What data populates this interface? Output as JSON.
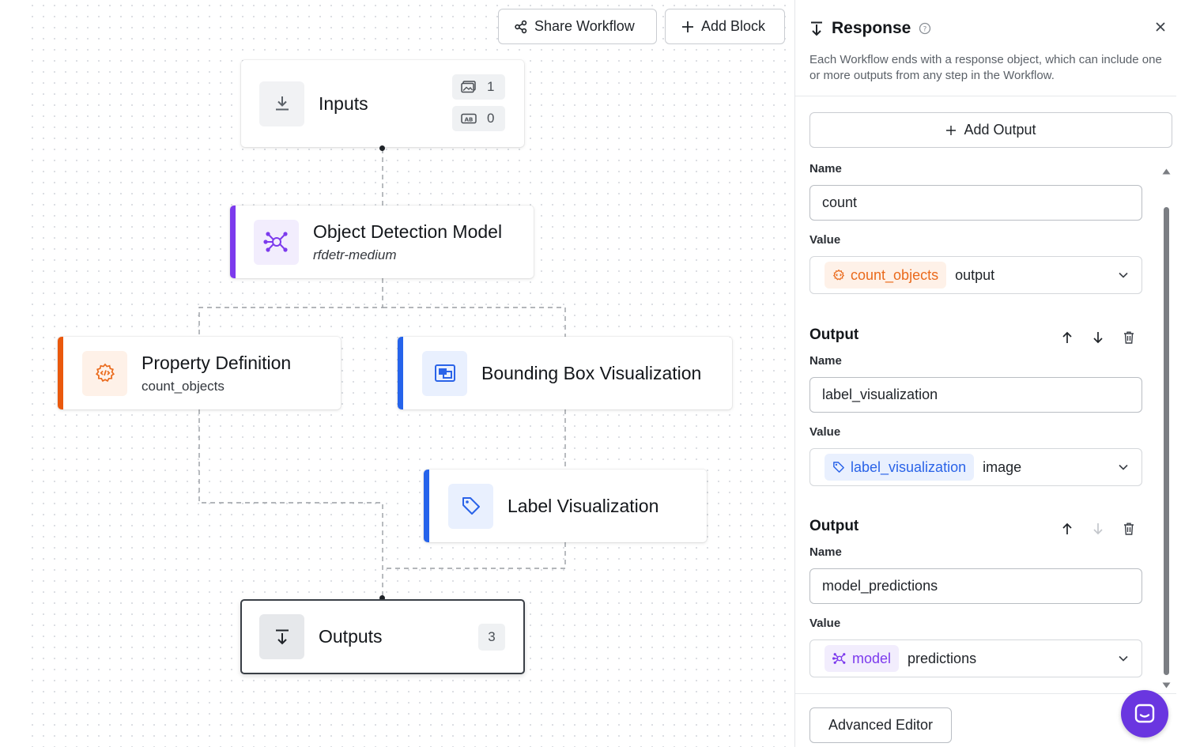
{
  "toolbar": {
    "share_label": "Share Workflow",
    "add_block_label": "Add Block"
  },
  "nodes": {
    "inputs": {
      "title": "Inputs",
      "image_count": "1",
      "param_count": "0"
    },
    "object_detection": {
      "title": "Object Detection Model",
      "subtitle": "rfdetr-medium",
      "accent": "#7c3aed"
    },
    "property_definition": {
      "title": "Property Definition",
      "subtitle": "count_objects",
      "accent": "#ea580c"
    },
    "bounding_box": {
      "title": "Bounding Box Visualization",
      "accent": "#2563eb"
    },
    "label_viz": {
      "title": "Label Visualization",
      "accent": "#2563eb"
    },
    "outputs": {
      "title": "Outputs",
      "count": "3"
    }
  },
  "panel": {
    "title": "Response",
    "description": "Each Workflow ends with a response object, which can include one or more outputs from any step in the Workflow.",
    "add_output_label": "Add Output",
    "outputs": [
      {
        "section_title": "",
        "name_label": "Name",
        "name_value": "count",
        "value_label": "Value",
        "chip_label": "count_objects",
        "chip_icon": "property-definition-icon",
        "selector_value": "output"
      },
      {
        "section_title": "Output",
        "name_label": "Name",
        "name_value": "label_visualization",
        "value_label": "Value",
        "chip_label": "label_visualization",
        "chip_icon": "tag-icon",
        "selector_value": "image"
      },
      {
        "section_title": "Output",
        "name_label": "Name",
        "name_value": "model_predictions",
        "value_label": "Value",
        "chip_label": "model",
        "chip_icon": "model-graph-icon",
        "selector_value": "predictions"
      }
    ],
    "advanced_editor_label": "Advanced Editor"
  },
  "colors": {
    "purple": "#7c3aed",
    "orange": "#ea6a1c",
    "blue": "#2a63e8",
    "chat": "#6a36e0"
  }
}
